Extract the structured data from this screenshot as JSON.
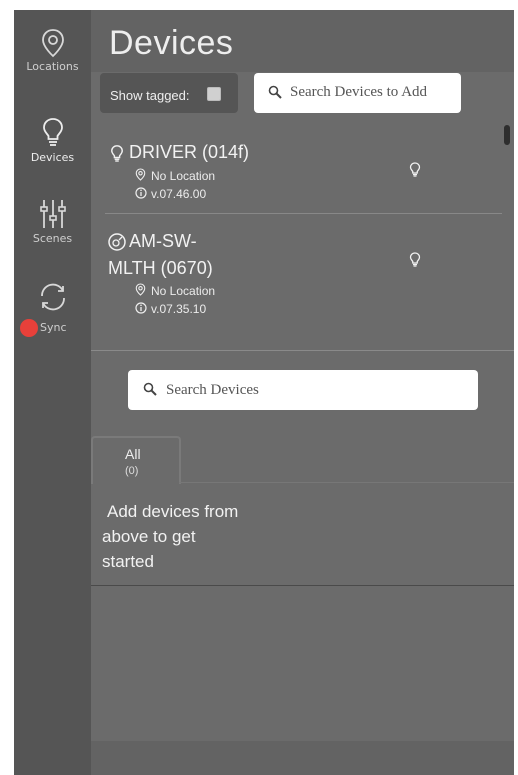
{
  "sidebar": {
    "items": [
      {
        "label": "Locations",
        "icon": "location-pin-icon"
      },
      {
        "label": "Devices",
        "icon": "lightbulb-icon"
      },
      {
        "label": "Scenes",
        "icon": "sliders-icon"
      },
      {
        "label": "Sync",
        "icon": "sync-icon",
        "status_color": "#e8403a"
      }
    ]
  },
  "header": {
    "title": "Devices"
  },
  "toolbar": {
    "show_tagged_label": "Show tagged:",
    "search_add_placeholder": "Search Devices to Add"
  },
  "devices": [
    {
      "name": "DRIVER (014f)",
      "location": "No Location",
      "version": "v.07.46.00",
      "icon": "lightbulb-icon"
    },
    {
      "name_line1": "AM-SW-",
      "name_line2": "MLTH (0670)",
      "location": "No Location",
      "version": "v.07.35.10",
      "icon": "switch-icon"
    }
  ],
  "search_devices": {
    "placeholder": "Search Devices"
  },
  "tabs": [
    {
      "label": "All",
      "count": "(0)"
    }
  ],
  "empty_message": {
    "line1": "Add devices from",
    "line2": "above to get",
    "line3": "started"
  },
  "colors": {
    "sidebar_bg": "#555555",
    "main_bg": "#6b6b6b",
    "sync_dot": "#e8403a"
  }
}
